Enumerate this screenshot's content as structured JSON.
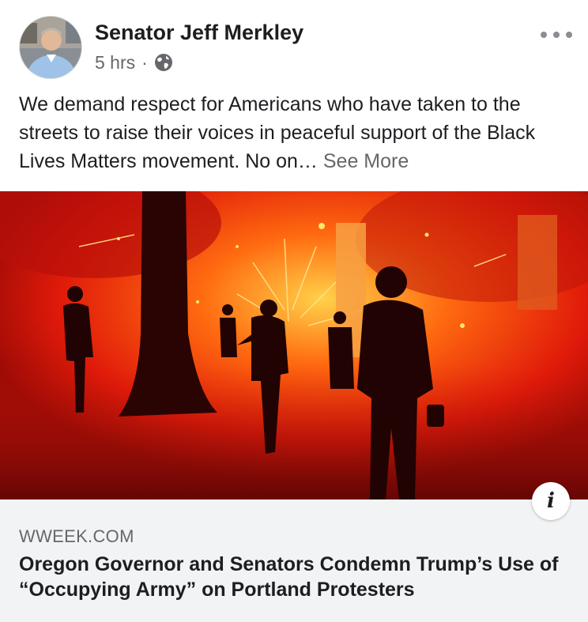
{
  "post": {
    "author": "Senator Jeff Merkley",
    "timestamp": "5 hrs",
    "separator": "·",
    "privacy_icon": "globe-icon",
    "text": "We demand respect for Americans who have taken to the streets to raise their voices in peaceful support of the Black Lives Matters movement. No on…",
    "see_more": "See More",
    "more_icon": "ellipsis-icon"
  },
  "link": {
    "domain": "WWEEK.COM",
    "title": "Oregon Governor and Senators Condemn Trump’s Use of “Occupying Army” on Portland Protesters",
    "info_label": "i"
  },
  "colors": {
    "text_primary": "#1c1e21",
    "text_secondary": "#65676b",
    "preview_background": "#f2f3f5"
  }
}
